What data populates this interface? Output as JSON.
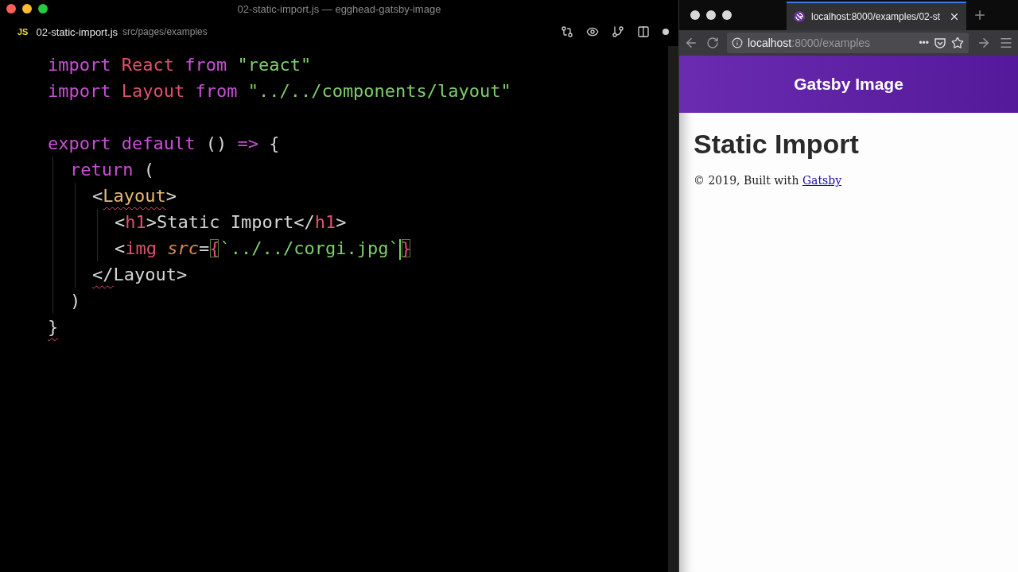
{
  "window": {
    "title": "02-static-import.js — egghead-gatsby-image"
  },
  "editor_tab": {
    "badge": "JS",
    "filename": "02-static-import.js",
    "path": "src/pages/examples",
    "modified": true
  },
  "code_lines": [
    {
      "kind": "code",
      "tokens": [
        {
          "kind": "keyword",
          "text": "import "
        },
        {
          "kind": "name",
          "text": "React "
        },
        {
          "kind": "keyword",
          "text": "from "
        },
        {
          "kind": "string",
          "text": "\"react\""
        }
      ]
    },
    {
      "kind": "code",
      "tokens": [
        {
          "kind": "keyword",
          "text": "import "
        },
        {
          "kind": "name",
          "text": "Layout "
        },
        {
          "kind": "keyword",
          "text": "from "
        },
        {
          "kind": "string",
          "text": "\"../../components/layout\""
        }
      ]
    },
    {
      "kind": "blank"
    },
    {
      "kind": "code",
      "tokens": [
        {
          "kind": "keyword",
          "text": "export default "
        },
        {
          "kind": "plain",
          "text": "() "
        },
        {
          "kind": "keyword",
          "text": "=> "
        },
        {
          "kind": "plain",
          "text": "{"
        }
      ],
      "children": [
        {
          "kind": "code",
          "tokens": [
            {
              "kind": "keyword",
              "text": "return "
            },
            {
              "kind": "plain",
              "text": "("
            }
          ],
          "children": [
            {
              "kind": "code",
              "tokens": [
                {
                  "kind": "plain",
                  "text": "<"
                },
                {
                  "kind": "component",
                  "text": "Layout",
                  "error": true
                },
                {
                  "kind": "plain",
                  "text": ">"
                }
              ],
              "children": [
                {
                  "kind": "code",
                  "tokens": [
                    {
                      "kind": "plain",
                      "text": "<"
                    },
                    {
                      "kind": "name",
                      "text": "h1"
                    },
                    {
                      "kind": "plain",
                      "text": ">Static Import</"
                    },
                    {
                      "kind": "name",
                      "text": "h1"
                    },
                    {
                      "kind": "plain",
                      "text": ">"
                    }
                  ]
                },
                {
                  "kind": "code",
                  "tokens": [
                    {
                      "kind": "plain",
                      "text": "<"
                    },
                    {
                      "kind": "name",
                      "text": "img "
                    },
                    {
                      "kind": "attr",
                      "text": "src"
                    },
                    {
                      "kind": "plain",
                      "text": "="
                    },
                    {
                      "kind": "name",
                      "text": "{",
                      "matched": true
                    },
                    {
                      "kind": "string",
                      "text": "`../../corgi.jpg`",
                      "cursor": true
                    },
                    {
                      "kind": "name",
                      "text": "}",
                      "matched": true
                    }
                  ]
                }
              ]
            },
            {
              "kind": "code",
              "tokens": [
                {
                  "kind": "plain",
                  "text": "</",
                  "error": true
                },
                {
                  "kind": "plain",
                  "text": "Layout>"
                }
              ]
            }
          ]
        },
        {
          "kind": "code",
          "tokens": [
            {
              "kind": "plain",
              "text": ")"
            }
          ]
        }
      ]
    },
    {
      "kind": "code",
      "tokens": [
        {
          "kind": "plain",
          "text": "}",
          "error": true
        }
      ]
    }
  ],
  "browser": {
    "tab_title": "localhost:8000/examples/02-st",
    "url_host": "localhost",
    "url_rest": ":8000/examples",
    "more": "•••",
    "site_title": "Gatsby Image",
    "heading": "Static Import",
    "footer_text": "© 2019, Built with ",
    "footer_link": "Gatsby"
  }
}
